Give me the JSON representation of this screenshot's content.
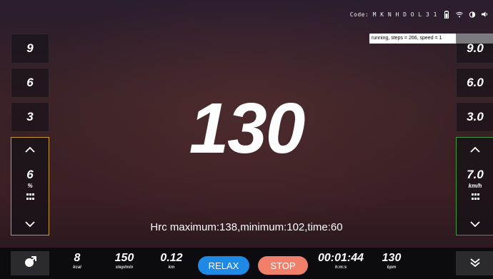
{
  "status": {
    "code": "Code: M K N H D O L 3 1",
    "icons": [
      "battery-icon",
      "wifi-icon",
      "brightness-icon",
      "volume-icon"
    ]
  },
  "debug_text": "running, steps = 266, speed = 1",
  "left_quick": [
    "9",
    "6",
    "3"
  ],
  "right_quick": [
    "9.0",
    "6.0",
    "3.0"
  ],
  "incline": {
    "value": "6",
    "unit": "%"
  },
  "speed": {
    "value": "7.0",
    "unit": "km/h"
  },
  "main_value": "130",
  "hrc_text": "Hrc maximum:138,minimum:102,time:60",
  "bottom": {
    "kcal": {
      "value": "8",
      "unit": "kcal"
    },
    "steps": {
      "value": "150",
      "unit": "step/min"
    },
    "distance": {
      "value": "0.12",
      "unit": "km"
    },
    "relax_label": "RELAX",
    "stop_label": "STOP",
    "time": {
      "value": "00:01:44",
      "unit": "h:m:s"
    },
    "bpm": {
      "value": "130",
      "unit": "bpm"
    }
  },
  "colors": {
    "relax": "#1f8ae6",
    "stop": "#f0806a",
    "incline_border": "#c89a2a",
    "speed_border": "#3b9a3b"
  }
}
